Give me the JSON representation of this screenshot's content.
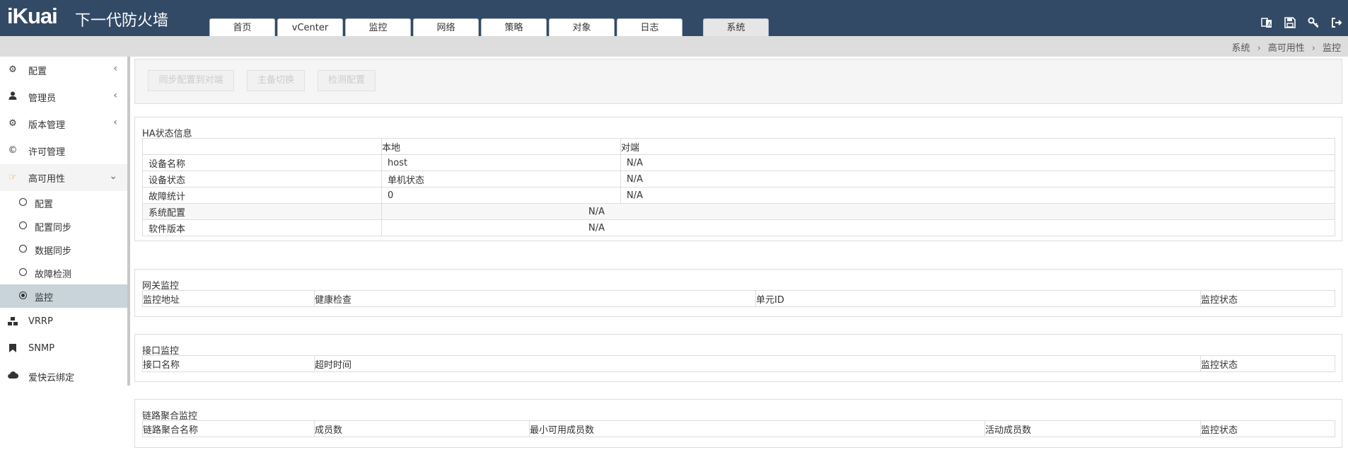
{
  "header": {
    "logo": "iKuai",
    "product": "下一代防火墙",
    "tabs": [
      "首页",
      "vCenter",
      "监控",
      "网络",
      "策略",
      "对象",
      "日志",
      "系统"
    ],
    "active_tab": "系统",
    "icons": [
      "translate-icon",
      "save-icon",
      "key-icon",
      "logout-icon"
    ]
  },
  "breadcrumb": [
    "系统",
    "高可用性",
    "监控"
  ],
  "sidebar": {
    "items": [
      {
        "label": "配置",
        "icon": "gears-icon",
        "chevron": "‹"
      },
      {
        "label": "管理员",
        "icon": "user-icon",
        "chevron": "‹"
      },
      {
        "label": "版本管理",
        "icon": "gear-icon",
        "chevron": "‹"
      },
      {
        "label": "许可管理",
        "icon": "copyright-icon",
        "chevron": ""
      },
      {
        "label": "高可用性",
        "icon": "hand-point-icon",
        "chevron": "⌄"
      },
      {
        "label": "VRRP",
        "icon": "cubes-icon",
        "chevron": ""
      },
      {
        "label": "SNMP",
        "icon": "bookmark-icon",
        "chevron": ""
      },
      {
        "label": "爱快云绑定",
        "icon": "cloud-icon",
        "chevron": ""
      }
    ],
    "subitems": [
      "配置",
      "配置同步",
      "数据同步",
      "故障检测",
      "监控"
    ],
    "selected_subitem": "监控"
  },
  "toolbar": {
    "buttons": [
      "同步配置到对端",
      "主备切换",
      "检测配置"
    ]
  },
  "ha_status": {
    "title": "HA状态信息",
    "col_local": "本地",
    "col_peer": "对端",
    "rows": [
      {
        "label": "设备名称",
        "local": "host",
        "peer": "N/A"
      },
      {
        "label": "设备状态",
        "local": "单机状态",
        "peer": "N/A"
      },
      {
        "label": "故障统计",
        "local": "0",
        "peer": "N/A"
      }
    ],
    "merged_rows": [
      {
        "label": "系统配置",
        "value": "N/A"
      },
      {
        "label": "软件版本",
        "value": "N/A"
      }
    ]
  },
  "gateway_monitor": {
    "title": "网关监控",
    "columns": [
      "监控地址",
      "健康检查",
      "单元ID",
      "监控状态"
    ]
  },
  "interface_monitor": {
    "title": "接口监控",
    "columns": [
      "接口名称",
      "超时时间",
      "监控状态"
    ]
  },
  "lag_monitor": {
    "title": "链路聚合监控",
    "columns": [
      "链路聚合名称",
      "成员数",
      "最小可用成员数",
      "活动成员数",
      "监控状态"
    ]
  }
}
